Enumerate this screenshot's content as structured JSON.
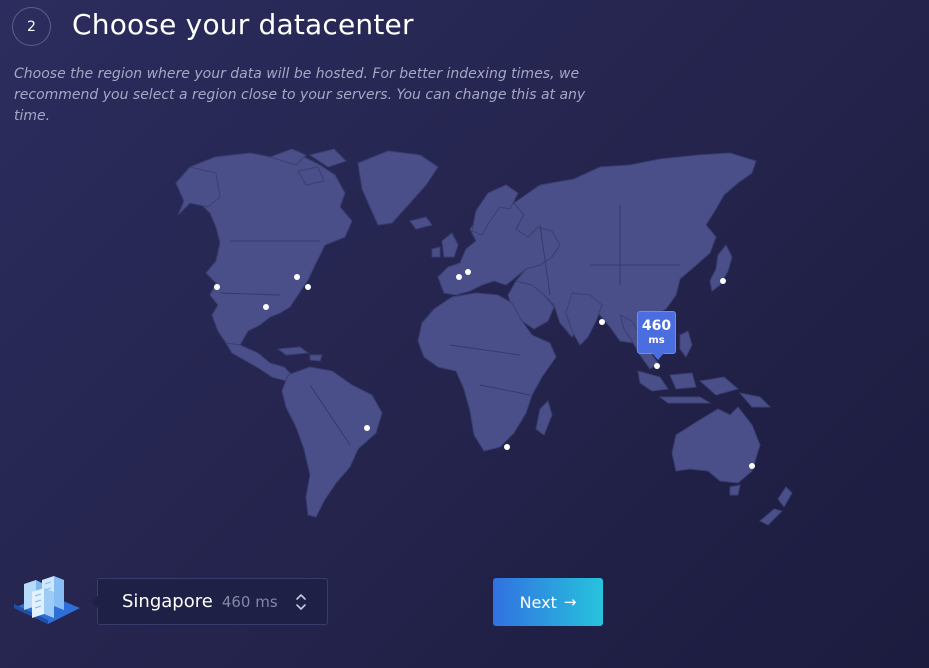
{
  "step": {
    "number": "2",
    "title": "Choose your datacenter"
  },
  "description": "Choose the region where your data will be hosted. For better indexing times, we recommend you select a region close to your servers. You can change this at any time.",
  "map": {
    "tooltip": {
      "value": "460",
      "unit": "ms"
    },
    "colors": {
      "land": "#4a4f8a",
      "dot": "#ffffff",
      "tooltip": "#4a6ee0"
    }
  },
  "selector": {
    "city": "Singapore",
    "latency": "460 ms"
  },
  "next_button": {
    "label": "Next",
    "icon": "arrow-right-icon"
  },
  "accent": {
    "button_start": "#3171e0",
    "button_end": "#27c3dd"
  }
}
